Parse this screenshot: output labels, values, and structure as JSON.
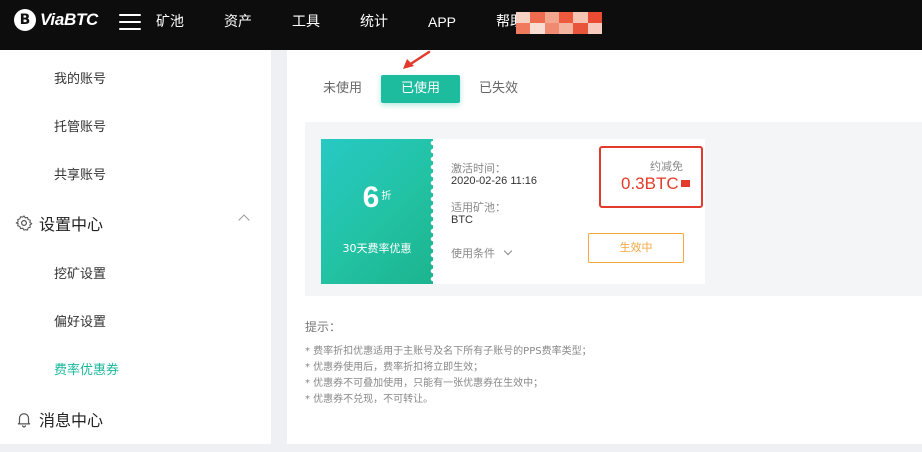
{
  "brand": {
    "logo_mark": "B",
    "name": "ViaBTC"
  },
  "nav": {
    "items": [
      "矿池",
      "资产",
      "工具",
      "统计",
      "APP",
      "帮助"
    ]
  },
  "user": {
    "avatar_colors": [
      "#f6d2c4",
      "#ef6b4d",
      "#f4a58d",
      "#ee5a3e",
      "#f7c3b2",
      "#e94c33",
      "#ef7a5e",
      "#f9ddd2",
      "#f08a70",
      "#f3b4a0",
      "#e8553b",
      "#f6cbbd"
    ]
  },
  "sidebar": {
    "account_items": [
      "我的账号",
      "托管账号",
      "共享账号"
    ],
    "settings_group": "设置中心",
    "settings_items": [
      "挖矿设置",
      "偏好设置",
      "费率优惠券"
    ],
    "message_group": "消息中心"
  },
  "tabs": [
    "未使用",
    "已使用",
    "已失效"
  ],
  "voucher": {
    "discount": "6",
    "discount_unit": "折",
    "description": "30天费率优惠",
    "activate_label": "激活时间：",
    "activate_time": "2020-02-26 11:16",
    "pool_label": "适用矿池：",
    "pool": "BTC",
    "condition_label": "使用条件",
    "reduce_label": "约减免",
    "reduce_value": "0.3BTC",
    "status": "生效中"
  },
  "tips": {
    "title": "提示：",
    "items": [
      "* 费率折扣优惠适用于主账号及名下所有子账号的PPS费率类型；",
      "* 优惠券使用后，费率折扣将立即生效；",
      "* 优惠券不可叠加使用，只能有一张优惠券在生效中；",
      "* 优惠券不兑现，不可转让。"
    ]
  },
  "colors": {
    "accent": "#1ebc9e",
    "highlight": "#e23b2e",
    "status": "#f5a640"
  }
}
